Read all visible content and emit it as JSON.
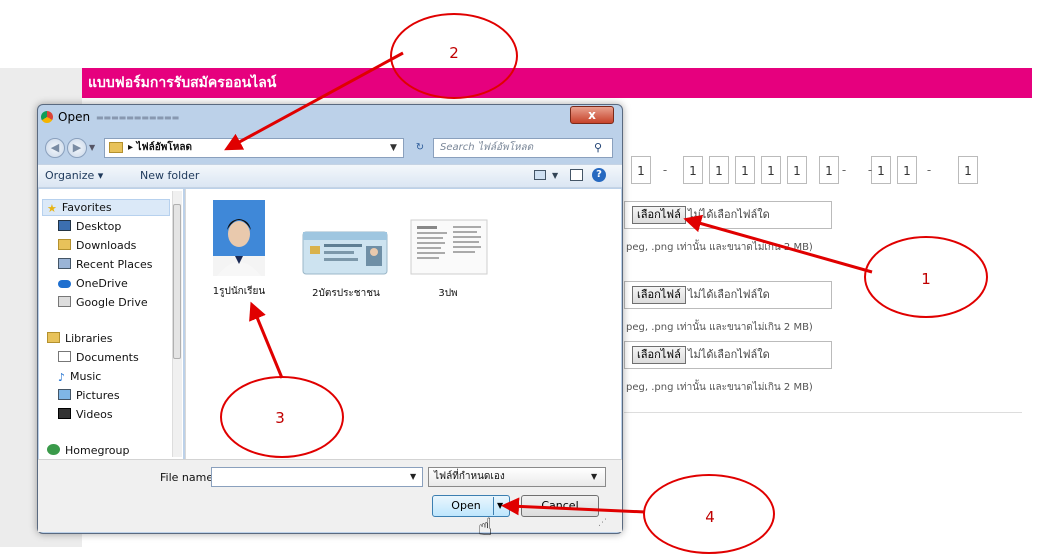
{
  "form": {
    "header": "แบบฟอร์มการรับสมัครออนไลน์",
    "id_digits": [
      "1",
      "1",
      "1",
      "1",
      "1",
      "1",
      "1",
      "1",
      "1"
    ],
    "id_dash": "-",
    "file_button_label": "เลือกไฟล์",
    "file_status": "ไม่ได้เลือกไฟล์ใด",
    "file_status_partial": "ไม่ได้เลือกไฟล์ใด",
    "file_hint_partial": "peg, .png เท่านั้น และขนาดไม่เกิน 2 MB)",
    "file_hint": "peg, .png เท่านั้น และขนาดไม่เกิน 2 MB)"
  },
  "dialog": {
    "title": "Open",
    "close_label": "x",
    "address": {
      "separator": "▸",
      "current_folder": "ไฟล์อัพโหลด"
    },
    "search": {
      "placeholder": "Search ไฟล์อัพโหลด"
    },
    "toolbar": {
      "organize": "Organize ▾",
      "new_folder": "New folder"
    },
    "nav": {
      "favorites": "Favorites",
      "favorite_items": [
        "Desktop",
        "Downloads",
        "Recent Places",
        "OneDrive",
        "Google Drive"
      ],
      "libraries": "Libraries",
      "library_items": [
        "Documents",
        "Music",
        "Pictures",
        "Videos"
      ],
      "homegroup": "Homegroup"
    },
    "files": [
      {
        "name": "1รูปนักเรียน",
        "icon": "student-photo"
      },
      {
        "name": "2บัตรประชาชน",
        "icon": "id-card-image"
      },
      {
        "name": "3ปพ",
        "icon": "transcript-document"
      }
    ],
    "file_name_label": "File name:",
    "file_name_value": "",
    "file_type": "ไฟล์ที่กำหนดเอง",
    "open_label": "Open",
    "cancel_label": "Cancel"
  },
  "annotations": {
    "callouts": [
      "1",
      "2",
      "3",
      "4"
    ],
    "color": "#e00000"
  },
  "colors": {
    "form_header": "#e6007e",
    "dialog_frame": "#bcd1e9",
    "open_button": "#bee6fd"
  }
}
